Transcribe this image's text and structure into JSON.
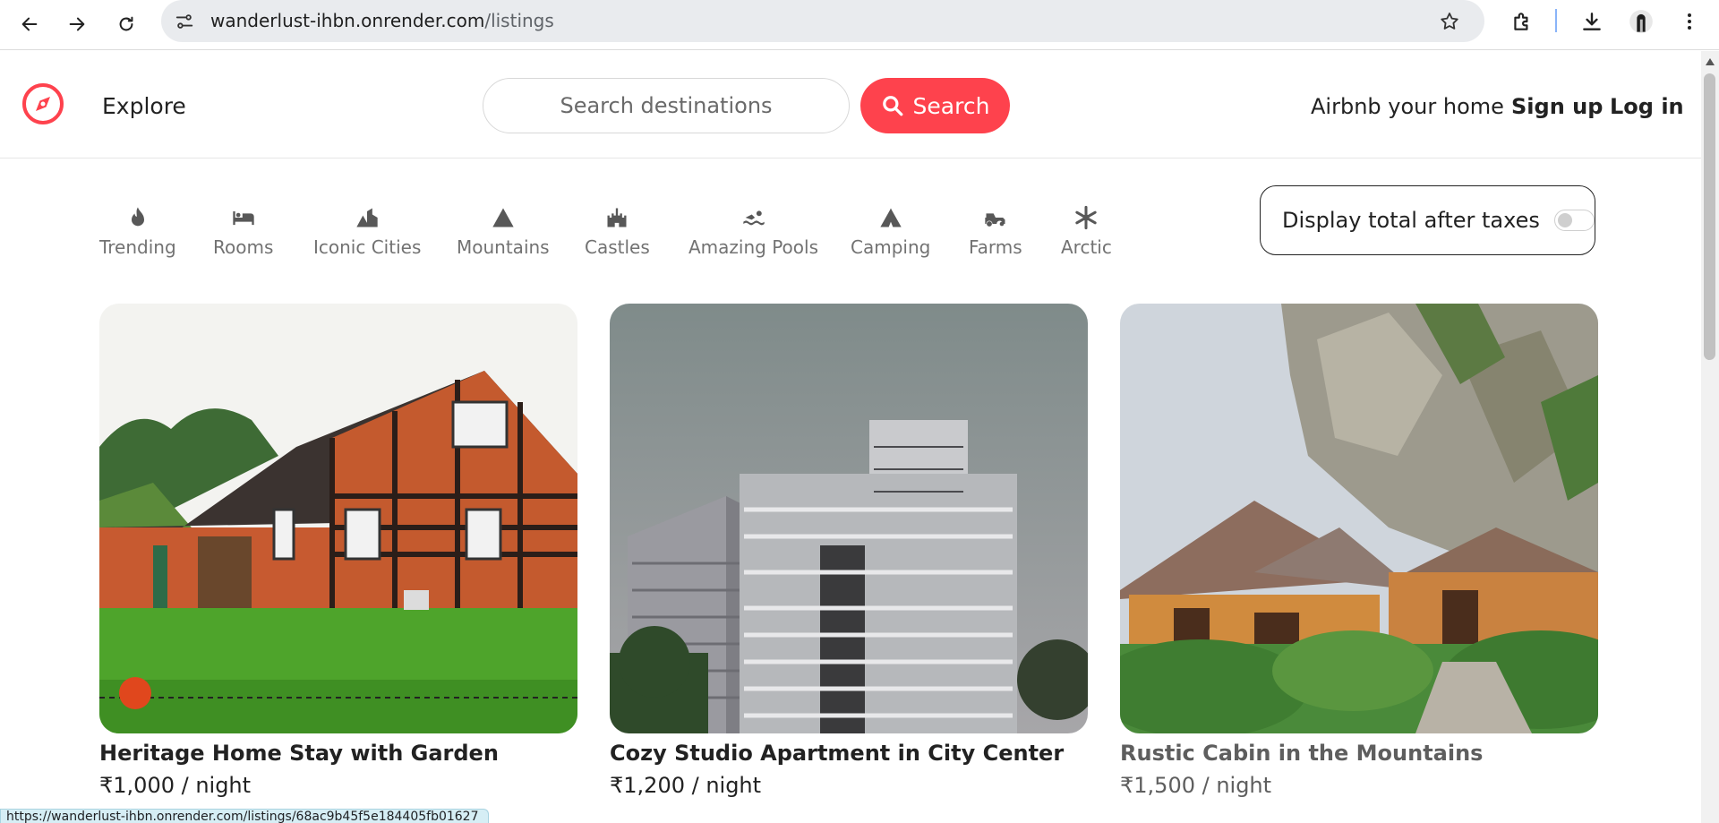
{
  "browser": {
    "url_host": "wanderlust-ihbn.onrender.com",
    "url_path": "/listings",
    "status_url": "https://wanderlust-ihbn.onrender.com/listings/68ac9b45f5e184405fb01627"
  },
  "navbar": {
    "explore_label": "Explore",
    "search_placeholder": "Search destinations",
    "search_button_label": "Search",
    "host_label": "Airbnb your home",
    "signup_label": "Sign up",
    "login_label": "Log in",
    "accent_color": "#fe424d"
  },
  "filters": [
    {
      "label": "Trending",
      "icon": "fire-icon"
    },
    {
      "label": "Rooms",
      "icon": "bed-icon"
    },
    {
      "label": "Iconic Cities",
      "icon": "city-icon"
    },
    {
      "label": "Mountains",
      "icon": "mountain-icon"
    },
    {
      "label": "Castles",
      "icon": "castle-icon"
    },
    {
      "label": "Amazing Pools",
      "icon": "swimmer-icon"
    },
    {
      "label": "Camping",
      "icon": "tent-icon"
    },
    {
      "label": "Farms",
      "icon": "tractor-icon"
    },
    {
      "label": "Arctic",
      "icon": "snowflake-icon"
    }
  ],
  "tax_toggle": {
    "label": "Display total after taxes",
    "enabled": false
  },
  "listings": [
    {
      "title": "Heritage Home Stay with Garden",
      "price": "₹1,000 / night"
    },
    {
      "title": "Cozy Studio Apartment in City Center",
      "price": "₹1,200 / night"
    },
    {
      "title": "Rustic Cabin in the Mountains",
      "price": "₹1,500 / night"
    }
  ]
}
